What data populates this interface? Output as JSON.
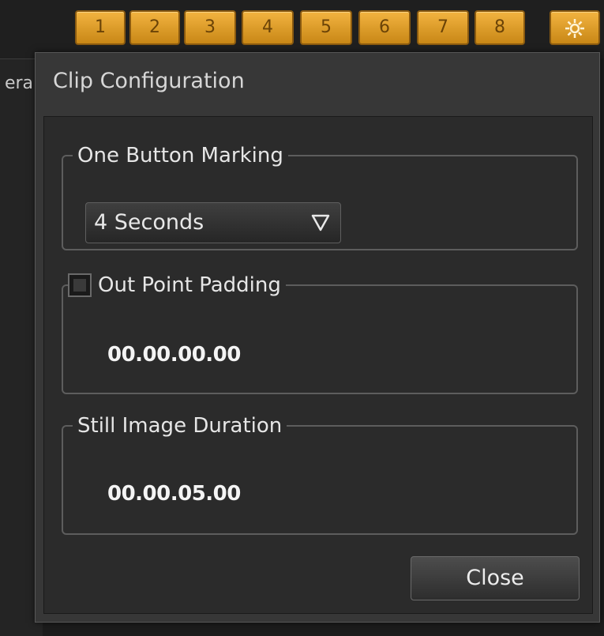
{
  "toolbar": {
    "number_buttons": [
      "1",
      "2",
      "3",
      "4",
      "5",
      "6",
      "7",
      "8"
    ],
    "settings_icon": "gear-icon",
    "accent_color": "#e0a02a"
  },
  "left_panel": {
    "tab_label": "era"
  },
  "dialog": {
    "title": "Clip Configuration",
    "one_button_marking": {
      "legend": "One Button Marking",
      "selected": "4 Seconds"
    },
    "out_point_padding": {
      "legend": "Out Point Padding",
      "checked": false,
      "value": "00.00.00.00"
    },
    "still_image_duration": {
      "legend": "Still Image Duration",
      "value": "00.00.05.00"
    },
    "close_label": "Close"
  }
}
